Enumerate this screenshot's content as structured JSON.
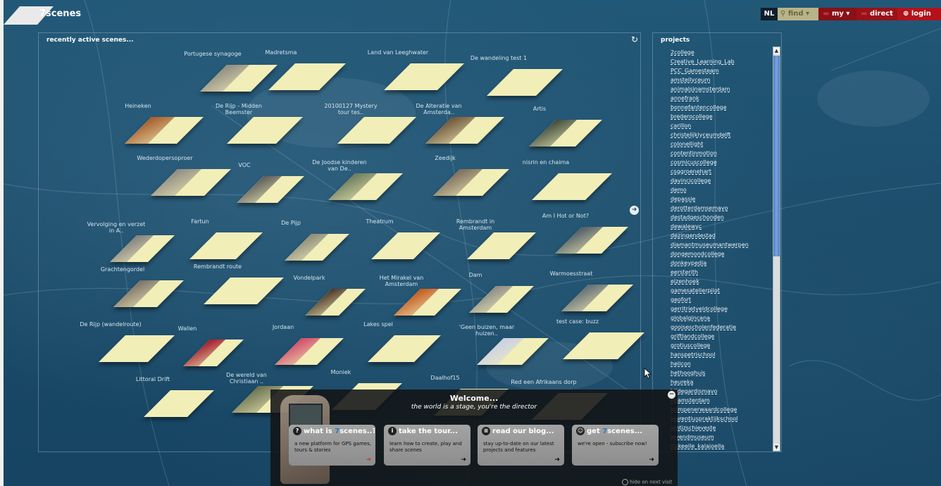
{
  "app": {
    "name_prefix": "7",
    "name": "scenes"
  },
  "menu": {
    "lang": "NL",
    "find": "find",
    "my": "my",
    "direct": "direct",
    "login": "login"
  },
  "scenes_panel": {
    "title": "recently active scenes..."
  },
  "projects_panel": {
    "title": "projects"
  },
  "scenes": [
    {
      "label": "Portugese synagoge",
      "photo": true,
      "photo_color": "#8d8a80"
    },
    {
      "label": "Madretsma",
      "photo": false
    },
    {
      "label": "Land van Leeghwater",
      "photo": false
    },
    {
      "label": "De wandeling test 1",
      "photo": false
    },
    {
      "label": "Heineken",
      "photo": true,
      "photo_color": "#a45a2a"
    },
    {
      "label": "De Rijp - Midden Beemster",
      "photo": false
    },
    {
      "label": "20100127 Mystery tour tes..",
      "photo": false
    },
    {
      "label": "De Alteratie van Amsterda..",
      "photo": true,
      "photo_color": "#6b5238"
    },
    {
      "label": "Artis",
      "photo": true,
      "photo_color": "#3c4a3a"
    },
    {
      "label": "Wederdopersoproer",
      "photo": true,
      "photo_color": "#8f8b81"
    },
    {
      "label": "VOC",
      "photo": true,
      "photo_color": "#5a5a5a"
    },
    {
      "label": "De Joodse kinderen van De..",
      "photo": true,
      "photo_color": "#6a7a5a"
    },
    {
      "label": "Zeedijk",
      "photo": true,
      "photo_color": "#7a6a5a"
    },
    {
      "label": "nisrin en chaima",
      "photo": false
    },
    {
      "label": "Vervolging en verzet in A..",
      "photo": true,
      "photo_color": "#7f7f7f"
    },
    {
      "label": "Fartun",
      "photo": false
    },
    {
      "label": "De Pijp",
      "photo": true,
      "photo_color": "#8a8a7a"
    },
    {
      "label": "Theatrum",
      "photo": false
    },
    {
      "label": "Rembrandt in Amsterdam",
      "photo": false
    },
    {
      "label": "Am I Hot or Not?",
      "photo": true,
      "photo_color": "#4e5a64"
    },
    {
      "label": "Grachtengordel",
      "photo": true,
      "photo_color": "#7a7066"
    },
    {
      "label": "Rembrandt route",
      "photo": false
    },
    {
      "label": "Vondelpark",
      "photo": true,
      "photo_color": "#4a3426"
    },
    {
      "label": "Het Mirakel van Amsterdam",
      "photo": true,
      "photo_color": "#c2581e"
    },
    {
      "label": "Dam",
      "photo": true,
      "photo_color": "#8a8a86"
    },
    {
      "label": "Warmoesstraat",
      "photo": true,
      "photo_color": "#5e6a72"
    },
    {
      "label": "De Rijp (wandelroute)",
      "photo": false
    },
    {
      "label": "Wallen",
      "photo": true,
      "photo_color": "#a0182a"
    },
    {
      "label": "Jordaan",
      "photo": true,
      "photo_color": "#d04a6a"
    },
    {
      "label": "Lakes spel",
      "photo": false
    },
    {
      "label": "'Geen buizen, maar huizen..",
      "photo": true,
      "photo_color": "#c8d0e6"
    },
    {
      "label": "test case: buzz",
      "photo": false
    },
    {
      "label": "Littoral Drift",
      "photo": false
    },
    {
      "label": "De wereld van Christiaan ..",
      "photo": true,
      "photo_color": "#6a7050"
    },
    {
      "label": "Moniek",
      "photo": false
    },
    {
      "label": "Daalhof15",
      "photo": false
    },
    {
      "label": "Red een Afrikaans dorp",
      "photo": false
    }
  ],
  "projects": [
    "2college",
    "Creative_Learning_Lab",
    "PCC_Gamesteam",
    "amstelIyceum",
    "animalsinamsterdam",
    "annefrank",
    "bonnefantencollege",
    "brederocollege",
    "carillon",
    "christelijklyceumdelft",
    "colonellight",
    "contentinmotion",
    "cosmicuscollege",
    "csggroenehart",
    "davincicollege",
    "demo",
    "depassie",
    "derotterdamsemavo",
    "destadgeschonden",
    "dewalewyc",
    "dezingendestad",
    "diamantmuseumantwerpen",
    "dongemondcollege",
    "donkeypedia",
    "eersterith",
    "elzenhoek",
    "gamesatelierpilot",
    "geofort",
    "gerritrietveldcollege",
    "globalgincana",
    "gooisescholenfederatie",
    "griftlandcollege",
    "grotiuscollege",
    "hanspetrischool",
    "helicon",
    "hethooghuis",
    "heureka",
    "hildegardismavo",
    "hoamsterdam",
    "krimpenerwaardcollege",
    "laurentiuspraktijkschool",
    "lentizschieveste",
    "levendmuseum",
    "lliskeelle_kalajoella"
  ],
  "welcome": {
    "title": "Welcome...",
    "subtitle": "the world is a stage, you're the director",
    "cards": [
      {
        "icon": "?",
        "head_prefix": "what is ",
        "head_accent": "7",
        "head_suffix": "scenes..?",
        "body": "a new platform for GPS games, tours & stories"
      },
      {
        "icon": "i",
        "head_prefix": "take the tour...",
        "head_accent": "",
        "head_suffix": "",
        "body": "learn how to create, play and share scenes"
      },
      {
        "icon": "≡",
        "head_prefix": "read our blog...",
        "head_accent": "",
        "head_suffix": "",
        "body": "stay up-to-date on our latest projects and features"
      },
      {
        "icon": "☺",
        "head_prefix": "get ",
        "head_accent": "7",
        "head_suffix": "scenes...",
        "body": "we're open - subscribe now!"
      }
    ],
    "hide_next": "hide on next visit"
  },
  "colors": {
    "accent": "#2a7bc8",
    "login_red": "#b3121a",
    "tile": "#f2eeb8"
  }
}
